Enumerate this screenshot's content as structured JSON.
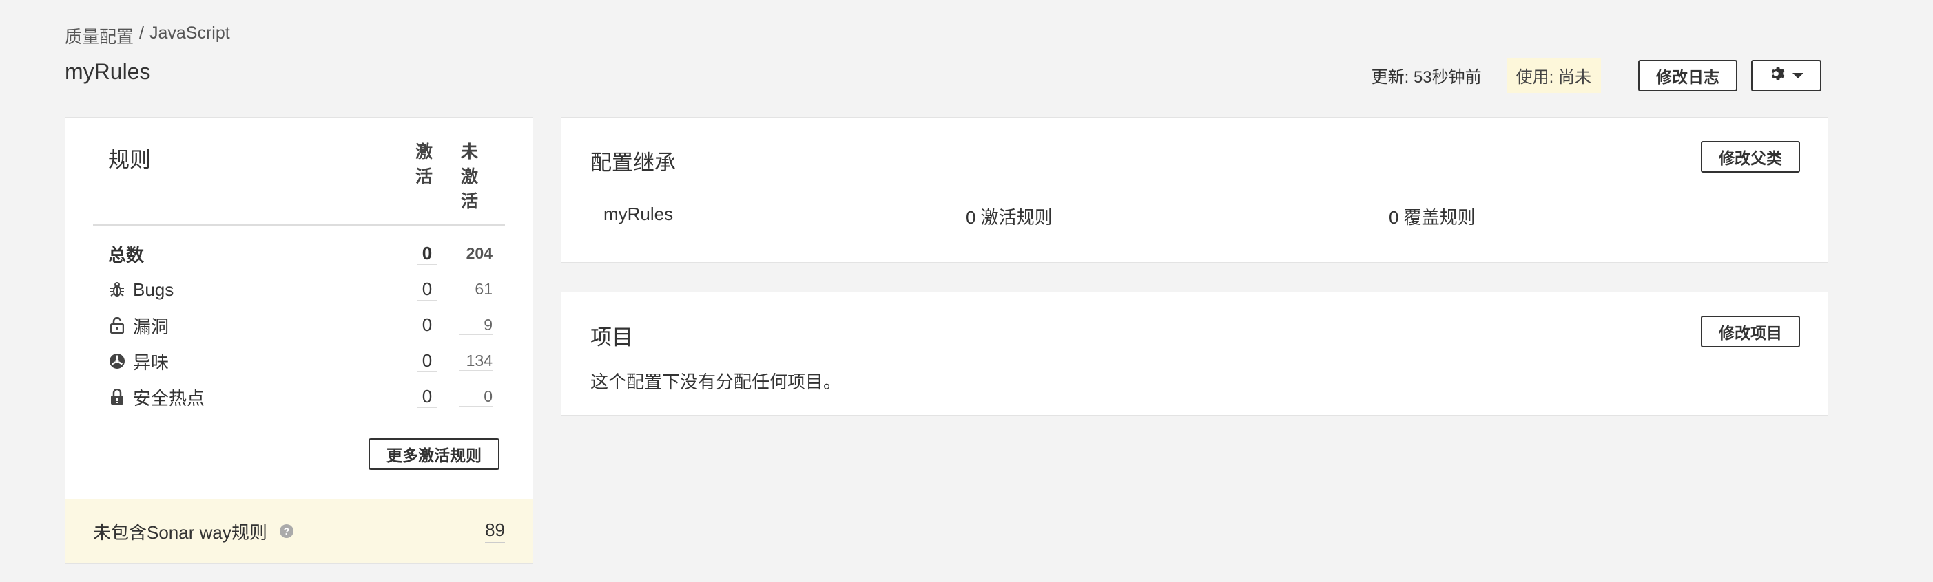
{
  "breadcrumb": {
    "root": "质量配置",
    "separator": "/",
    "language": "JavaScript"
  },
  "profile_name": "myRules",
  "header": {
    "updated": "更新: 53秒钟前",
    "usage": "使用: 尚未",
    "changelog_button": "修改日志",
    "settings_icon": "gear-icon"
  },
  "rules": {
    "title": "规则",
    "col_active": "激\n活",
    "col_inactive": "未\n激\n活",
    "rows": [
      {
        "label": "总数",
        "active": "0",
        "inactive": "204",
        "icon": ""
      },
      {
        "label": "Bugs",
        "active": "0",
        "inactive": "61",
        "icon": "bug-icon"
      },
      {
        "label": "漏洞",
        "active": "0",
        "inactive": "9",
        "icon": "lock-icon"
      },
      {
        "label": "异味",
        "active": "0",
        "inactive": "134",
        "icon": "code-smell-icon"
      },
      {
        "label": "安全热点",
        "active": "0",
        "inactive": "0",
        "icon": "security-hotspot-icon"
      }
    ],
    "more_button": "更多激活规则",
    "notice": {
      "text": "未包含Sonar way规则",
      "count": "89",
      "help_icon": "question-icon"
    }
  },
  "inheritance": {
    "title": "配置继承",
    "button": "修改父类",
    "name": "myRules",
    "active_rules": "0 激活规则",
    "overridden_rules": "0 覆盖规则"
  },
  "projects": {
    "title": "项目",
    "button": "修改项目",
    "empty": "这个配置下没有分配任何项目。"
  }
}
